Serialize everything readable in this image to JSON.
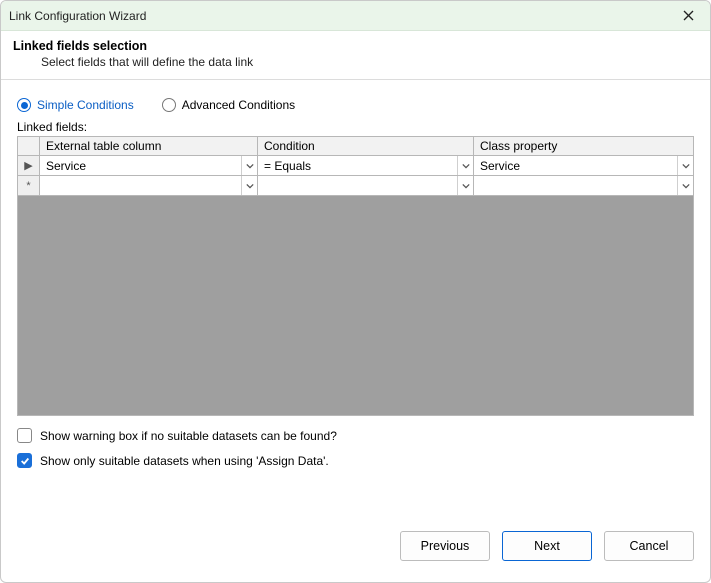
{
  "window": {
    "title": "Link Configuration Wizard"
  },
  "header": {
    "heading": "Linked fields selection",
    "sub": "Select fields that will define the data link"
  },
  "radios": {
    "simple_label": "Simple Conditions",
    "advanced_label": "Advanced Conditions",
    "selected": "simple"
  },
  "section_label": "Linked fields:",
  "grid": {
    "columns": [
      "External table column",
      "Condition",
      "Class property"
    ],
    "rows": [
      {
        "marker": "▶",
        "external": "Service",
        "condition": "= Equals",
        "class_property": "Service"
      },
      {
        "marker": "*",
        "external": "",
        "condition": "",
        "class_property": ""
      }
    ]
  },
  "checks": {
    "warn_label": "Show warning box if no suitable datasets can be found?",
    "warn_checked": false,
    "suitable_label": "Show only suitable datasets when using 'Assign Data'.",
    "suitable_checked": true
  },
  "buttons": {
    "previous": "Previous",
    "next": "Next",
    "cancel": "Cancel"
  }
}
